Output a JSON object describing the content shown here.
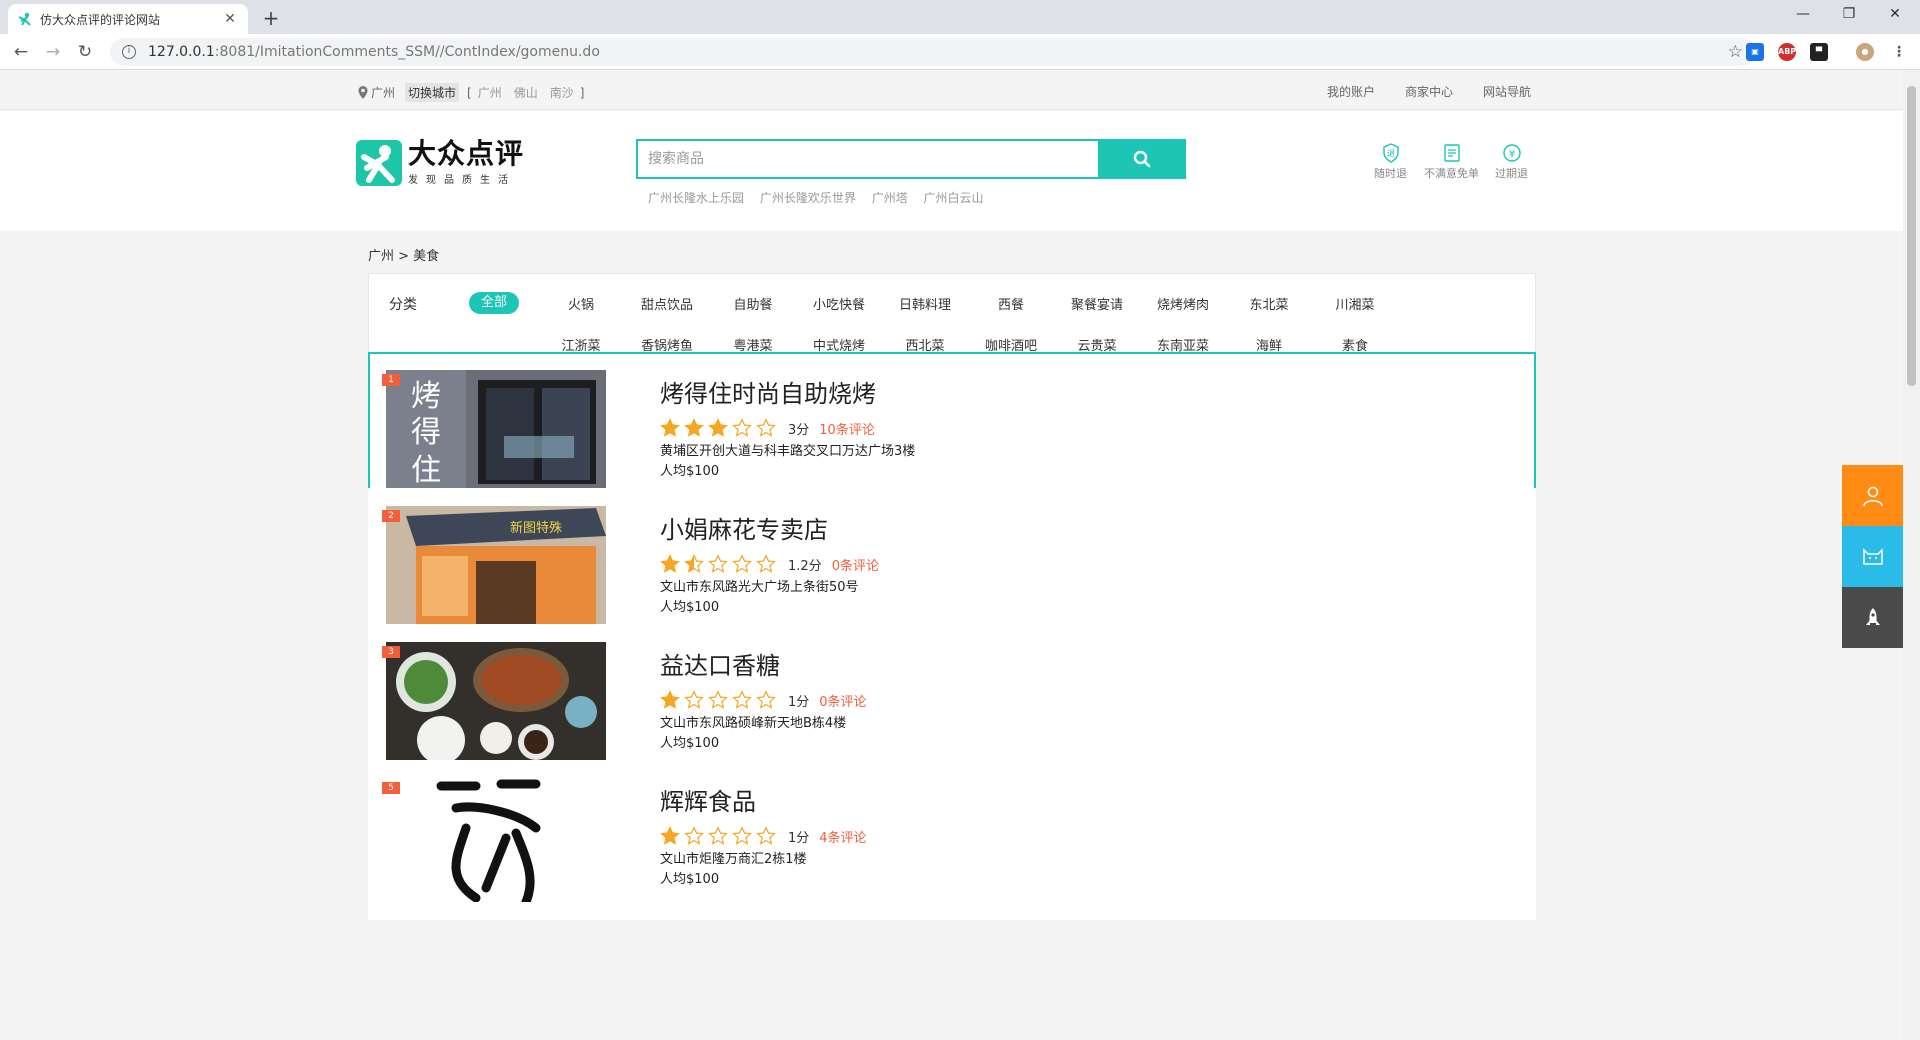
{
  "browser": {
    "tab_title": "仿大众点评的评论网站",
    "url_host": "127.0.0.1",
    "url_rest": ":8081/ImitationComments_SSM//ContIndex/gomenu.do",
    "ext_abp": "ABP"
  },
  "topbar": {
    "current_city": "广州",
    "switch_city": "切换城市",
    "bracket_open": "[",
    "bracket_close": "]",
    "cities": [
      "广州",
      "佛山",
      "南沙"
    ],
    "links": [
      "我的账户",
      "商家中心",
      "网站导航"
    ]
  },
  "header": {
    "brand": "大众点评",
    "slogan": "发现品质生活",
    "search_placeholder": "搜索商品",
    "hot_words": [
      "广州长隆水上乐园",
      "广州长隆欢乐世界",
      "广州塔",
      "广州白云山"
    ],
    "guarantees": [
      "随时退",
      "不满意免单",
      "过期退"
    ]
  },
  "breadcrumb": "广州 > 美食",
  "categories": {
    "label": "分类",
    "all": "全部",
    "row1": [
      "火锅",
      "甜点饮品",
      "自助餐",
      "小吃快餐",
      "日韩料理",
      "西餐",
      "聚餐宴请",
      "烧烤烤肉",
      "东北菜",
      "川湘菜"
    ],
    "row2": [
      "江浙菜",
      "香锅烤鱼",
      "粤港菜",
      "中式烧烤",
      "西北菜",
      "咖啡酒吧",
      "云贵菜",
      "东南亚菜",
      "海鲜",
      "素食"
    ]
  },
  "listings": [
    {
      "rank": "1",
      "name": "烤得住时尚自助烧烤",
      "rating": 3,
      "score": "3分",
      "reviews": "10条评论",
      "address": "黄埔区开创大道与科丰路交叉口万达广场3楼",
      "avg": "人均$100",
      "photo_text": [
        "烤",
        "得",
        "住"
      ]
    },
    {
      "rank": "2",
      "name": "小娟麻花专卖店",
      "rating": 1.2,
      "score": "1.2分",
      "reviews": "0条评论",
      "address": "文山市东风路光大广场上条街50号",
      "avg": "人均$100",
      "photo_text": [
        "新图特殊"
      ]
    },
    {
      "rank": "3",
      "name": "益达口香糖",
      "rating": 1,
      "score": "1分",
      "reviews": "0条评论",
      "address": "文山市东风路硕峰新天地B栋4楼",
      "avg": "人均$100"
    },
    {
      "rank": "5",
      "name": "辉辉食品",
      "rating": 1,
      "score": "1分",
      "reviews": "4条评论",
      "address": "文山市炬隆万商汇2栋1楼",
      "avg": "人均$100"
    }
  ],
  "colors": {
    "accent": "#1dc5b4",
    "rank": "#f35f3a",
    "star": "#f5a623",
    "side_orange": "#ff8a14",
    "side_blue": "#2bbbe8",
    "side_dark": "#4a4a4a"
  },
  "icons": {
    "side": [
      "user-icon",
      "cat-icon",
      "rocket-icon"
    ]
  }
}
